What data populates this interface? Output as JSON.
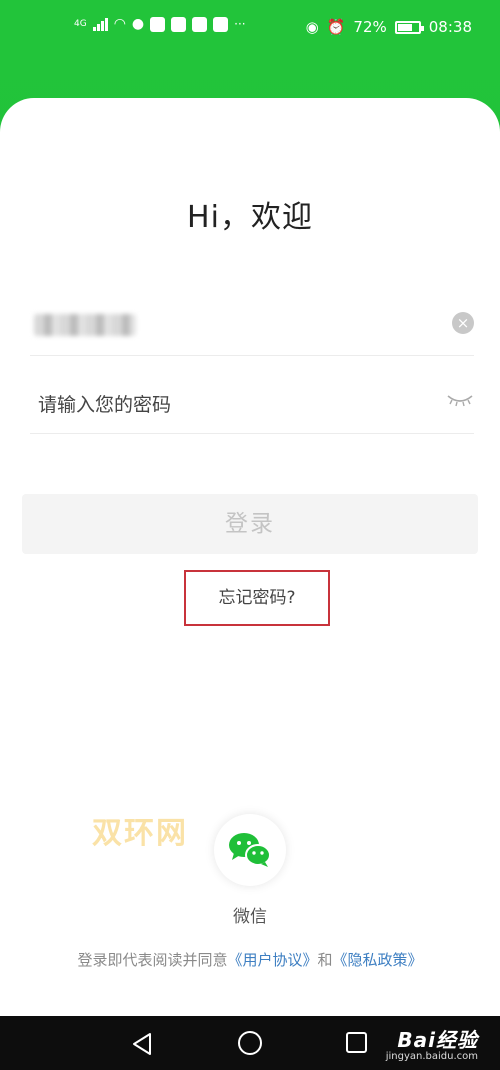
{
  "status_bar": {
    "network": "4G",
    "dots": "···",
    "battery": "72%",
    "time": "08:38"
  },
  "login": {
    "greeting": "Hi，欢迎",
    "password_placeholder": "请输入您的密码",
    "login_label": "登录",
    "forgot_label": "忘记密码?"
  },
  "watermark": {
    "text": "双环网",
    "baidu": "Bai经验",
    "baidu_url": "jingyan.baidu.com"
  },
  "social": {
    "wechat_label": "微信"
  },
  "agreement": {
    "prefix": "登录即代表阅读并同意",
    "user_agreement": "《用户协议》",
    "and": "和",
    "privacy_policy": "《隐私政策》"
  },
  "colors": {
    "brand_green": "#1fc238",
    "link_blue": "#3e7fc2",
    "highlight_red": "#c8333b"
  }
}
